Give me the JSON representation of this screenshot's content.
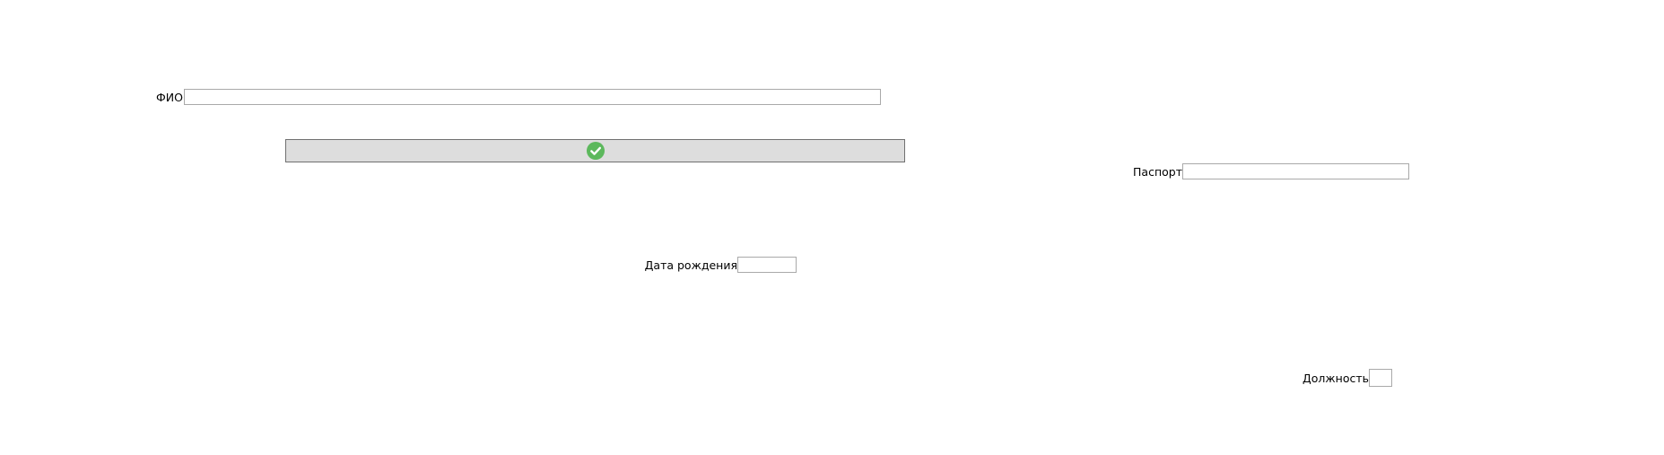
{
  "form": {
    "fio": {
      "label": "ФИО",
      "value": ""
    },
    "passport": {
      "label": "Паспорт",
      "value": ""
    },
    "birth_date": {
      "label": "Дата рождения",
      "value": ""
    },
    "position": {
      "label": "Должность",
      "value": ""
    },
    "confirm_button": {
      "icon": "check-circle-icon"
    }
  },
  "colors": {
    "button_bg": "#dddddd",
    "button_border": "#707070",
    "check_icon": "#5cb85c",
    "field_border": "#a9a9a9"
  }
}
